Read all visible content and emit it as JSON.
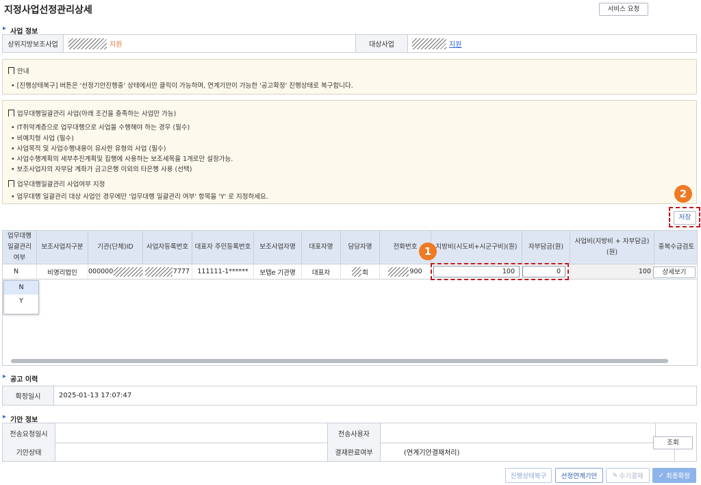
{
  "page_title": "지정사업선정관리상세",
  "service_request_label": "서비스 요청",
  "business_info": {
    "title": "사업 정보",
    "upper_label": "상위지방보조사업",
    "upper_value": "지원",
    "target_label": "대상사업",
    "target_value": "지원"
  },
  "notice1": {
    "head": "안내",
    "text": "[진행상태복구] 버튼은 '선정기안진행중' 상태에서만 클릭이 가능하며, 연계기안이 가능한 '공고확정' 진행상태로 복구합니다."
  },
  "notice2": {
    "head": "업무대행일괄관리 사업(아래 조건을 충족하는 사업만 가능)",
    "items": [
      "IT취약계층으로 업무대행으로 사업을 수행해야 하는 경우 (필수)",
      "비예치형 사업 (필수)",
      "사업목적 및 사업수행내용이 유사한 유형의 사업 (필수)",
      "사업수행계획의 세부추진계획및 집행에 사용하는 보조세목을 1개로만 설정가능.",
      "보조사업자의 자부담 계좌가 금고은행 이외의 타은행 사용 (선택)"
    ],
    "head2": "업무대행일괄관리 사업여부 지정",
    "text2": "업무대행 일괄관리 대상 사업인 경우에만 '업무대행 일괄관리 여부' 항목을 'Y' 로 지정하세요."
  },
  "save_label": "저장",
  "badge1": "1",
  "badge2": "2",
  "grid": {
    "headers": [
      "업무대행\n일괄관리\n여부",
      "보조사업자구분",
      "기관(단체)ID",
      "사업자등록번호",
      "대표자 주민등록번호",
      "보조사업자명",
      "대표자명",
      "담당자명",
      "전화번호",
      "지방비(시도비+시군구비)(원)",
      "자부담금(원)",
      "사업비(지방비 + 자부담금)(원)",
      "중복수급검토"
    ],
    "row": {
      "flag": "N",
      "type": "비영리법인",
      "org_id_prefix": "000000",
      "biz_no_suffix": "7777",
      "rrn": "111111-1******",
      "name": "보텝e 기관명",
      "ceo": "대표자",
      "manager_suffix": "희",
      "phone_suffix": "900",
      "local_fund": "100",
      "self_fund": "0",
      "total": "100",
      "detail_label": "상세보기"
    },
    "dropdown_options": [
      "N",
      "Y"
    ]
  },
  "announce": {
    "title": "공고 이력",
    "confirm_label": "확정일시",
    "confirm_value": "2025-01-13 17:07:47"
  },
  "draft": {
    "title": "기안 정보",
    "send_date_label": "전송요청일시",
    "send_date_value": "",
    "sender_label": "전송사용자",
    "sender_value": "",
    "status_label": "기안상태",
    "status_value": "",
    "approval_label": "결재완료여부",
    "approval_value": "(연계기안결재처리)",
    "query_label": "조회"
  },
  "bottom_buttons": {
    "restore": "진행상태복구",
    "linked_draft": "선정연계기안",
    "manual_approval": "수기결재",
    "final_confirm": "최종확정"
  },
  "colors": {
    "accent": "#3a6fd8",
    "highlight_red": "#c0161a",
    "badge_orange": "#ee7a24",
    "final_button": "#8fb4ea"
  }
}
